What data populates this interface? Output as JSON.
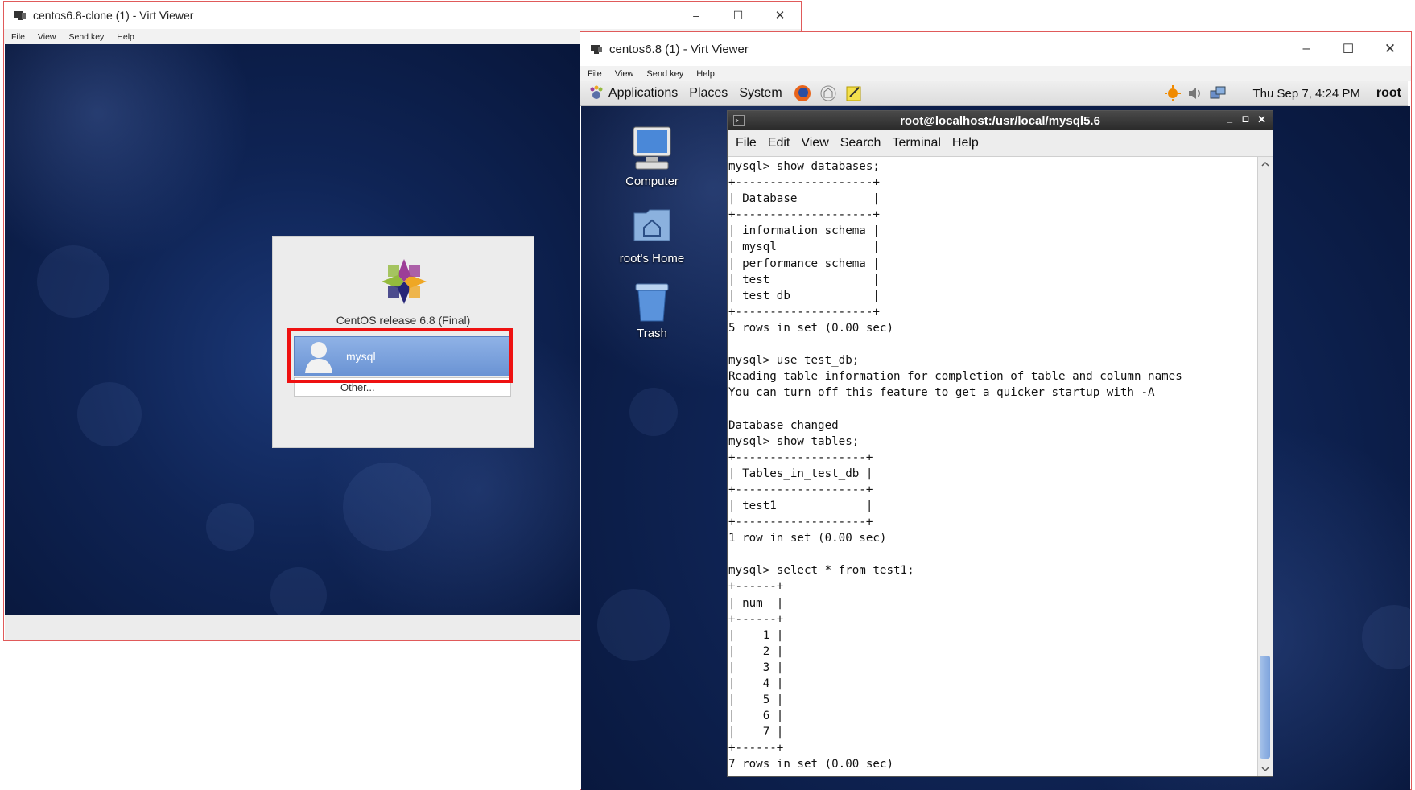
{
  "window_left": {
    "title": "centos6.8-clone (1) - Virt Viewer",
    "menu": [
      "File",
      "View",
      "Send key",
      "Help"
    ],
    "controls": {
      "minimize": "–",
      "maximize": "☐",
      "close": "✕"
    },
    "login": {
      "release_text": "CentOS release 6.8 (Final)",
      "user_name": "mysql",
      "other_label": "Other..."
    }
  },
  "window_right": {
    "title": "centos6.8 (1) - Virt Viewer",
    "menu": [
      "File",
      "View",
      "Send key",
      "Help"
    ],
    "controls": {
      "minimize": "–",
      "maximize": "☐",
      "close": "✕"
    },
    "panel": {
      "apps": "Applications",
      "places": "Places",
      "system": "System",
      "clock": "Thu Sep  7,  4:24 PM",
      "user": "root"
    },
    "desktop_icons": {
      "computer": "Computer",
      "home": "root's Home",
      "trash": "Trash"
    },
    "terminal": {
      "title": "root@localhost:/usr/local/mysql5.6",
      "controls": {
        "minimize": "_",
        "maximize": "◻",
        "close": "✕"
      },
      "menu": [
        "File",
        "Edit",
        "View",
        "Search",
        "Terminal",
        "Help"
      ],
      "lines": [
        "mysql> show databases;",
        "+--------------------+",
        "| Database           |",
        "+--------------------+",
        "| information_schema |",
        "| mysql              |",
        "| performance_schema |",
        "| test               |",
        "| test_db            |",
        "+--------------------+",
        "5 rows in set (0.00 sec)",
        "",
        "mysql> use test_db;",
        "Reading table information for completion of table and column names",
        "You can turn off this feature to get a quicker startup with -A",
        "",
        "Database changed",
        "mysql> show tables;",
        "+-------------------+",
        "| Tables_in_test_db |",
        "+-------------------+",
        "| test1             |",
        "+-------------------+",
        "1 row in set (0.00 sec)",
        "",
        "mysql> select * from test1;",
        "+------+",
        "| num  |",
        "+------+",
        "|    1 |",
        "|    2 |",
        "|    3 |",
        "|    4 |",
        "|    5 |",
        "|    6 |",
        "|    7 |",
        "+------+",
        "7 rows in set (0.00 sec)"
      ]
    }
  }
}
